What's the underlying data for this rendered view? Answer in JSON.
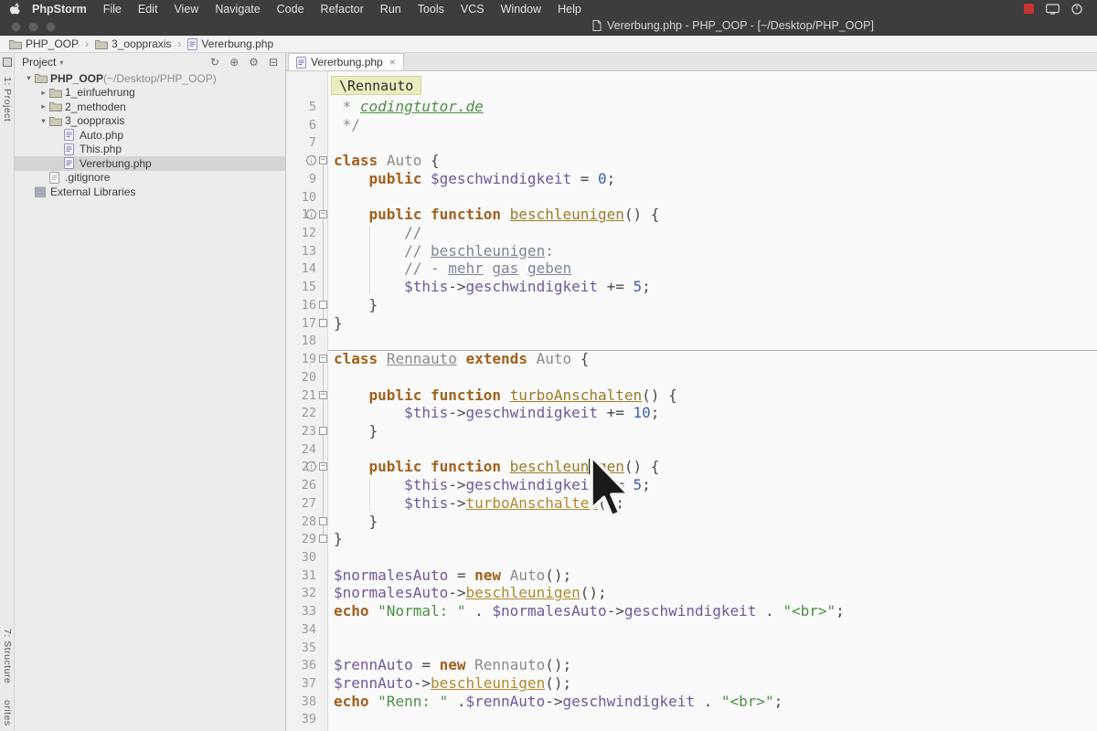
{
  "menu_bar": {
    "items": [
      "PhpStorm",
      "File",
      "Edit",
      "View",
      "Navigate",
      "Code",
      "Refactor",
      "Run",
      "Tools",
      "VCS",
      "Window",
      "Help"
    ],
    "status_icons": [
      "record-icon",
      "display-icon",
      "power-icon"
    ],
    "window_title": "Vererbung.php - PHP_OOP - [~/Desktop/PHP_OOP]"
  },
  "nav_breadcrumbs": [
    {
      "label": "PHP_OOP",
      "icon": "folder"
    },
    {
      "label": "3_ooppraxis",
      "icon": "folder"
    },
    {
      "label": "Vererbung.php",
      "icon": "php"
    }
  ],
  "tool_strip": {
    "top_label": "1: Project",
    "structure_label": "7: Structure",
    "favorites_label": "orites"
  },
  "project_panel": {
    "title": "Project",
    "header_icons": [
      "refresh",
      "locate",
      "gear",
      "collapse"
    ],
    "tree": [
      {
        "label": "PHP_OOP",
        "path": "(~/Desktop/PHP_OOP)",
        "type": "folder",
        "level": 0,
        "expanded": true,
        "bold": true
      },
      {
        "label": "1_einfuehrung",
        "type": "folder",
        "level": 1,
        "expanded": false
      },
      {
        "label": "2_methoden",
        "type": "folder",
        "level": 1,
        "expanded": false
      },
      {
        "label": "3_ooppraxis",
        "type": "folder",
        "level": 1,
        "expanded": true
      },
      {
        "label": "Auto.php",
        "type": "php",
        "level": 2
      },
      {
        "label": "This.php",
        "type": "php",
        "level": 2
      },
      {
        "label": "Vererbung.php",
        "type": "php",
        "level": 2,
        "selected": true
      },
      {
        "label": ".gitignore",
        "type": "file",
        "level": 1
      },
      {
        "label": "External Libraries",
        "type": "lib",
        "level": 0
      }
    ]
  },
  "editor": {
    "tab": {
      "label": "Vererbung.php",
      "close": "×"
    },
    "context_crumb": "\\Rennauto",
    "first_line": 5,
    "caret": {
      "line": 25,
      "col": 29
    },
    "fold_starts": [
      8,
      11,
      19,
      21,
      25
    ],
    "fold_ends": [
      16,
      17,
      23,
      28,
      29
    ],
    "fold_ranges": [
      {
        "from": 8,
        "to": 17
      },
      {
        "from": 19,
        "to": 29
      }
    ],
    "gutter_icons": [
      {
        "line": 8,
        "dir": "down"
      },
      {
        "line": 11,
        "dir": "down"
      },
      {
        "line": 25,
        "dir": "up"
      }
    ],
    "indent_guides": [
      {
        "col": 4,
        "from": 12,
        "to": 15
      },
      {
        "col": 4,
        "from": 26,
        "to": 27
      }
    ],
    "lines": [
      {
        "n": 5,
        "tokens": [
          {
            "t": " * ",
            "c": "gray"
          },
          {
            "t": "codingtutor.de",
            "c": "link"
          }
        ]
      },
      {
        "n": 6,
        "tokens": [
          {
            "t": " */",
            "c": "gray"
          }
        ]
      },
      {
        "n": 7,
        "tokens": []
      },
      {
        "n": 8,
        "tokens": [
          {
            "t": "class",
            "c": "kw"
          },
          {
            "t": " ",
            "c": "pln"
          },
          {
            "t": "Auto",
            "c": "cls"
          },
          {
            "t": " {",
            "c": "pln"
          }
        ]
      },
      {
        "n": 9,
        "tokens": [
          {
            "t": "    ",
            "c": "pln"
          },
          {
            "t": "public",
            "c": "kw"
          },
          {
            "t": " ",
            "c": "pln"
          },
          {
            "t": "$geschwindigkeit",
            "c": "var"
          },
          {
            "t": " = ",
            "c": "pln"
          },
          {
            "t": "0",
            "c": "num"
          },
          {
            "t": ";",
            "c": "pln"
          }
        ]
      },
      {
        "n": 10,
        "tokens": []
      },
      {
        "n": 11,
        "tokens": [
          {
            "t": "    ",
            "c": "pln"
          },
          {
            "t": "public",
            "c": "kw"
          },
          {
            "t": " ",
            "c": "pln"
          },
          {
            "t": "function",
            "c": "kw"
          },
          {
            "t": " ",
            "c": "pln"
          },
          {
            "t": "beschleunigen",
            "c": "fn"
          },
          {
            "t": "() {",
            "c": "pln"
          }
        ]
      },
      {
        "n": 12,
        "tokens": [
          {
            "t": "        //",
            "c": "com"
          }
        ]
      },
      {
        "n": 13,
        "tokens": [
          {
            "t": "        // ",
            "c": "com"
          },
          {
            "t": "beschleunigen",
            "c": "comu"
          },
          {
            "t": ":",
            "c": "com"
          }
        ]
      },
      {
        "n": 14,
        "tokens": [
          {
            "t": "        // - ",
            "c": "com"
          },
          {
            "t": "mehr",
            "c": "comu"
          },
          {
            "t": " ",
            "c": "com"
          },
          {
            "t": "gas",
            "c": "comu"
          },
          {
            "t": " ",
            "c": "com"
          },
          {
            "t": "geben",
            "c": "comu"
          }
        ]
      },
      {
        "n": 15,
        "tokens": [
          {
            "t": "        ",
            "c": "pln"
          },
          {
            "t": "$this",
            "c": "var"
          },
          {
            "t": "->",
            "c": "pln"
          },
          {
            "t": "geschwindigkeit",
            "c": "var"
          },
          {
            "t": " += ",
            "c": "pln"
          },
          {
            "t": "5",
            "c": "num"
          },
          {
            "t": ";",
            "c": "pln"
          }
        ]
      },
      {
        "n": 16,
        "tokens": [
          {
            "t": "    }",
            "c": "pln"
          }
        ]
      },
      {
        "n": 17,
        "tokens": [
          {
            "t": "}",
            "c": "pln"
          }
        ]
      },
      {
        "n": 18,
        "tokens": []
      },
      {
        "n": 19,
        "sep": true,
        "tokens": [
          {
            "t": "class",
            "c": "kw"
          },
          {
            "t": " ",
            "c": "pln"
          },
          {
            "t": "Rennauto",
            "c": "clsu"
          },
          {
            "t": " ",
            "c": "pln"
          },
          {
            "t": "extends",
            "c": "kw"
          },
          {
            "t": " ",
            "c": "pln"
          },
          {
            "t": "Auto",
            "c": "cls"
          },
          {
            "t": " {",
            "c": "pln"
          }
        ]
      },
      {
        "n": 20,
        "tokens": []
      },
      {
        "n": 21,
        "tokens": [
          {
            "t": "    ",
            "c": "pln"
          },
          {
            "t": "public",
            "c": "kw"
          },
          {
            "t": " ",
            "c": "pln"
          },
          {
            "t": "function",
            "c": "kw"
          },
          {
            "t": " ",
            "c": "pln"
          },
          {
            "t": "turboAnschalten",
            "c": "fn"
          },
          {
            "t": "() {",
            "c": "pln"
          }
        ]
      },
      {
        "n": 22,
        "tokens": [
          {
            "t": "        ",
            "c": "pln"
          },
          {
            "t": "$this",
            "c": "var"
          },
          {
            "t": "->",
            "c": "pln"
          },
          {
            "t": "geschwindigkeit",
            "c": "var"
          },
          {
            "t": " += ",
            "c": "pln"
          },
          {
            "t": "10",
            "c": "num"
          },
          {
            "t": ";",
            "c": "pln"
          }
        ]
      },
      {
        "n": 23,
        "tokens": [
          {
            "t": "    }",
            "c": "pln"
          }
        ]
      },
      {
        "n": 24,
        "tokens": []
      },
      {
        "n": 25,
        "tokens": [
          {
            "t": "    ",
            "c": "pln"
          },
          {
            "t": "public",
            "c": "kw"
          },
          {
            "t": " ",
            "c": "pln"
          },
          {
            "t": "function",
            "c": "kw"
          },
          {
            "t": " ",
            "c": "pln"
          },
          {
            "t": "beschleunigen",
            "c": "fn"
          },
          {
            "t": "() {",
            "c": "pln"
          }
        ]
      },
      {
        "n": 26,
        "tokens": [
          {
            "t": "        ",
            "c": "pln"
          },
          {
            "t": "$this",
            "c": "var"
          },
          {
            "t": "->",
            "c": "pln"
          },
          {
            "t": "geschwindigkeit",
            "c": "var"
          },
          {
            "t": " += ",
            "c": "pln"
          },
          {
            "t": "5",
            "c": "num"
          },
          {
            "t": ";",
            "c": "pln"
          }
        ]
      },
      {
        "n": 27,
        "tokens": [
          {
            "t": "        ",
            "c": "pln"
          },
          {
            "t": "$this",
            "c": "var"
          },
          {
            "t": "->",
            "c": "pln"
          },
          {
            "t": "turboAnschalten",
            "c": "call"
          },
          {
            "t": "();",
            "c": "pln"
          }
        ]
      },
      {
        "n": 28,
        "tokens": [
          {
            "t": "    }",
            "c": "pln"
          }
        ]
      },
      {
        "n": 29,
        "tokens": [
          {
            "t": "}",
            "c": "pln"
          }
        ]
      },
      {
        "n": 30,
        "tokens": []
      },
      {
        "n": 31,
        "tokens": [
          {
            "t": "$normalesAuto",
            "c": "var"
          },
          {
            "t": " = ",
            "c": "pln"
          },
          {
            "t": "new",
            "c": "kw"
          },
          {
            "t": " ",
            "c": "pln"
          },
          {
            "t": "Auto",
            "c": "cls"
          },
          {
            "t": "();",
            "c": "pln"
          }
        ]
      },
      {
        "n": 32,
        "tokens": [
          {
            "t": "$normalesAuto",
            "c": "var"
          },
          {
            "t": "->",
            "c": "pln"
          },
          {
            "t": "beschleunigen",
            "c": "call"
          },
          {
            "t": "();",
            "c": "pln"
          }
        ]
      },
      {
        "n": 33,
        "tokens": [
          {
            "t": "echo",
            "c": "kw"
          },
          {
            "t": " ",
            "c": "pln"
          },
          {
            "t": "\"Normal: \"",
            "c": "str"
          },
          {
            "t": " . ",
            "c": "pln"
          },
          {
            "t": "$normalesAuto",
            "c": "var"
          },
          {
            "t": "->",
            "c": "pln"
          },
          {
            "t": "geschwindigkeit",
            "c": "var"
          },
          {
            "t": " . ",
            "c": "pln"
          },
          {
            "t": "\"<br>\"",
            "c": "str"
          },
          {
            "t": ";",
            "c": "pln"
          }
        ]
      },
      {
        "n": 34,
        "tokens": []
      },
      {
        "n": 35,
        "tokens": []
      },
      {
        "n": 36,
        "tokens": [
          {
            "t": "$rennAuto",
            "c": "var"
          },
          {
            "t": " = ",
            "c": "pln"
          },
          {
            "t": "new",
            "c": "kw"
          },
          {
            "t": " ",
            "c": "pln"
          },
          {
            "t": "Rennauto",
            "c": "cls"
          },
          {
            "t": "();",
            "c": "pln"
          }
        ]
      },
      {
        "n": 37,
        "tokens": [
          {
            "t": "$rennAuto",
            "c": "var"
          },
          {
            "t": "->",
            "c": "pln"
          },
          {
            "t": "beschleunigen",
            "c": "call"
          },
          {
            "t": "();",
            "c": "pln"
          }
        ]
      },
      {
        "n": 38,
        "tokens": [
          {
            "t": "echo",
            "c": "kw"
          },
          {
            "t": " ",
            "c": "pln"
          },
          {
            "t": "\"Renn: \"",
            "c": "str"
          },
          {
            "t": " .",
            "c": "pln"
          },
          {
            "t": "$rennAuto",
            "c": "var"
          },
          {
            "t": "->",
            "c": "pln"
          },
          {
            "t": "geschwindigkeit",
            "c": "var"
          },
          {
            "t": " . ",
            "c": "pln"
          },
          {
            "t": "\"<br>\"",
            "c": "str"
          },
          {
            "t": ";",
            "c": "pln"
          }
        ]
      },
      {
        "n": 39,
        "tokens": []
      }
    ]
  },
  "colors": {
    "syntax": {
      "kw": "#a2601c",
      "cls": "#8a8a8a",
      "fn": "#9a7b25",
      "call": "#b08a2e",
      "var": "#6f589e",
      "num": "#3c5cb5",
      "str": "#4d9044",
      "com": "#7b8795",
      "gray": "#8c8c8c",
      "pln": "#4a4a4a"
    },
    "ui": {
      "selection": "#d4d4d4",
      "crumb": "#ecedbe",
      "red": "#c8342f"
    }
  }
}
